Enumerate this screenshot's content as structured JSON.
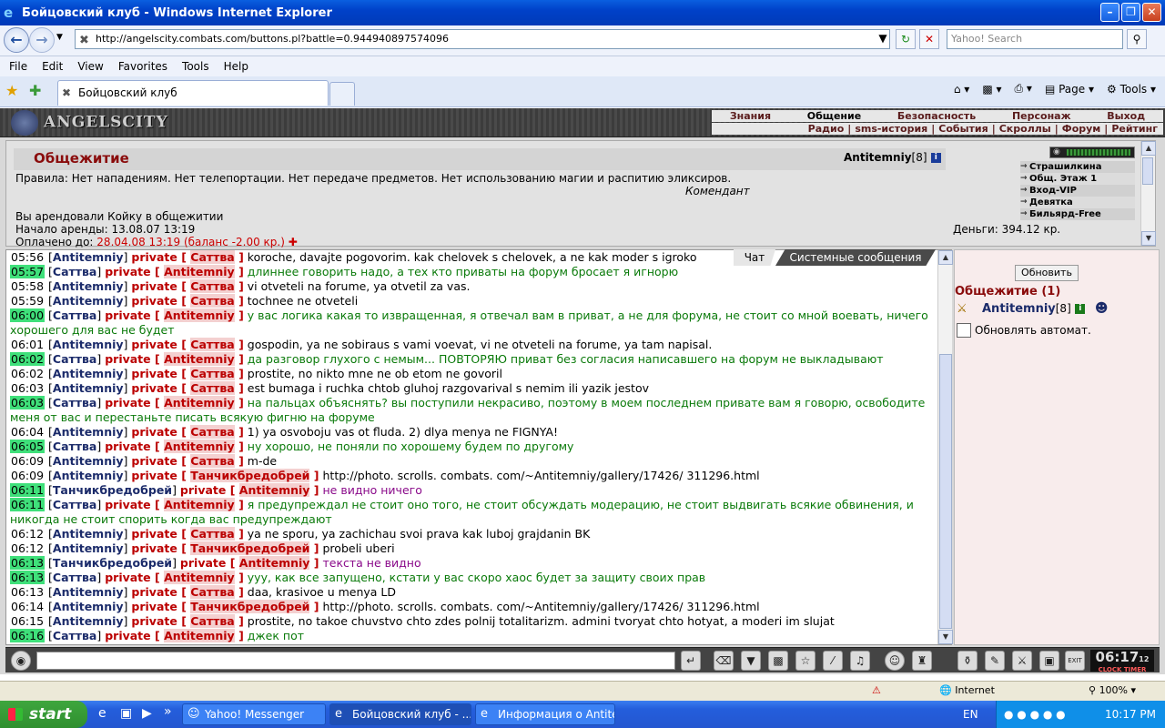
{
  "window": {
    "title": "Бойцовский клуб - Windows Internet Explorer"
  },
  "address": {
    "url": "http://angelscity.combats.com/buttons.pl?battle=0.944940897574096",
    "search_placeholder": "Yahoo! Search"
  },
  "menu": [
    "File",
    "Edit",
    "View",
    "Favorites",
    "Tools",
    "Help"
  ],
  "tabs": {
    "active": "Бойцовский клуб"
  },
  "commandbar": {
    "page": "Page",
    "tools": "Tools"
  },
  "site": {
    "logo": "ANGELSCITY",
    "topnav": [
      "Знания",
      "Общение",
      "Безопасность",
      "Персонаж",
      "Выход"
    ],
    "subnav": [
      "Радио",
      "sms-история",
      "События",
      "Скроллы",
      "Форум",
      "Рейтинг"
    ]
  },
  "room": {
    "title": "Общежитие",
    "user": "Antitemniy",
    "level": "[8]",
    "rules": "Правила: Нет нападениям. Нет телепортации. Нет передаче предметов. Нет использованию магии и распитию эликсиров.",
    "signed": "Комендант",
    "rent1": "Вы арендовали Койку в общежитии",
    "rent2": "Начало аренды: 13.08.07 13:19",
    "paid_label": "Оплачено до: ",
    "paid_value": "28.04.08 13:19 (баланс -2.00 кр.)",
    "money": "Деньги: 394.12 кр.",
    "links": [
      "Страшилкина улица",
      "Общ. Этаж 1",
      "Вход-VIP",
      "Девятка",
      "Бильярд-Free"
    ]
  },
  "chat_tabs": {
    "chat": "Чат",
    "system": "Системные сообщения"
  },
  "chat": [
    {
      "t": "05:56",
      "g": false,
      "n": "Antitemniy",
      "p": "Саттва",
      "m": "koroche, davajte pogovorim. kak chelovek s chelovek, a ne kak moder s igroko",
      "c": "m0"
    },
    {
      "t": "05:57",
      "g": true,
      "n": "Саттва",
      "p": "Antitemniy",
      "m": "длиннее говорить надо, а тех кто приваты на форум бросает я игнорю",
      "c": "mg"
    },
    {
      "t": "05:58",
      "g": false,
      "n": "Antitemniy",
      "p": "Саттва",
      "m": "vi otveteli na forume, ya otvetil za vas.",
      "c": "m0"
    },
    {
      "t": "05:59",
      "g": false,
      "n": "Antitemniy",
      "p": "Саттва",
      "m": "tochnee ne otveteli",
      "c": "m0"
    },
    {
      "t": "06:00",
      "g": true,
      "n": "Саттва",
      "p": "Antitemniy",
      "m": "у вас логика какая то извращенная, я отвечал вам в приват, а не для форума, не стоит со мной воевать, ничего хорошего для вас не будет",
      "c": "mg"
    },
    {
      "t": "06:01",
      "g": false,
      "n": "Antitemniy",
      "p": "Саттва",
      "m": "gospodin, ya ne sobiraus s vami voevat, vi ne otveteli na forume, ya tam napisal.",
      "c": "m0"
    },
    {
      "t": "06:02",
      "g": true,
      "n": "Саттва",
      "p": "Antitemniy",
      "m": "да разговор глухого с немым... ПОВТОРЯЮ приват без согласия написавшего на форум не выкладывают",
      "c": "mg"
    },
    {
      "t": "06:02",
      "g": false,
      "n": "Antitemniy",
      "p": "Саттва",
      "m": "prostite, no nikto mne ne ob etom ne govoril",
      "c": "m0"
    },
    {
      "t": "06:03",
      "g": false,
      "n": "Antitemniy",
      "p": "Саттва",
      "m": "est bumaga i ruchka chtob gluhoj razgovarival s nemim ili yazik jestov",
      "c": "m0"
    },
    {
      "t": "06:03",
      "g": true,
      "n": "Саттва",
      "p": "Antitemniy",
      "m": "на пальцах объяснять? вы поступили некрасиво, поэтому в моем последнем привате вам я говорю, освободите меня от вас и перестаньте писать всякую фигню на форуме",
      "c": "mg"
    },
    {
      "t": "06:04",
      "g": false,
      "n": "Antitemniy",
      "p": "Саттва",
      "m": "1) ya osvoboju vas ot fluda. 2) dlya menya ne FIGNYA!",
      "c": "m0"
    },
    {
      "t": "06:05",
      "g": true,
      "n": "Саттва",
      "p": "Antitemniy",
      "m": "ну хорошо, не поняли по хорошему будем по другому",
      "c": "mg"
    },
    {
      "t": "06:09",
      "g": false,
      "n": "Antitemniy",
      "p": "Саттва",
      "m": "m-de",
      "c": "m0"
    },
    {
      "t": "06:09",
      "g": false,
      "n": "Antitemniy",
      "p": "Танчикбредобрей",
      "m": "http://photo. scrolls. combats. com/~Antitemniy/gallery/17426/ 311296.html",
      "c": "m0"
    },
    {
      "t": "06:11",
      "g": true,
      "n": "Танчикбредобрей",
      "p": "Antitemniy",
      "m": "не видно ничего",
      "c": "mp"
    },
    {
      "t": "06:11",
      "g": true,
      "n": "Саттва",
      "p": "Antitemniy",
      "m": "я предупреждал не стоит оно того, не стоит обсуждать модерацию, не стоит выдвигать всякие обвинения, и никогда не стоит спорить когда вас предупреждают",
      "c": "mg"
    },
    {
      "t": "06:12",
      "g": false,
      "n": "Antitemniy",
      "p": "Саттва",
      "m": "ya ne sporu, ya zachichau svoi prava kak luboj grajdanin BK",
      "c": "m0"
    },
    {
      "t": "06:12",
      "g": false,
      "n": "Antitemniy",
      "p": "Танчикбредобрей",
      "m": "probeli uberi",
      "c": "m0"
    },
    {
      "t": "06:13",
      "g": true,
      "n": "Танчикбредобрей",
      "p": "Antitemniy",
      "m": "текста не видно",
      "c": "mp"
    },
    {
      "t": "06:13",
      "g": true,
      "n": "Саттва",
      "p": "Antitemniy",
      "m": "ууу, как все запущено, кстати у вас скоро хаос будет за защиту своих прав",
      "c": "mg"
    },
    {
      "t": "06:13",
      "g": false,
      "n": "Antitemniy",
      "p": "Саттва",
      "m": "daa, krasivoe u menya LD",
      "c": "m0"
    },
    {
      "t": "06:14",
      "g": false,
      "n": "Antitemniy",
      "p": "Танчикбредобрей",
      "m": "http://photo. scrolls. combats. com/~Antitemniy/gallery/17426/ 311296.html",
      "c": "m0"
    },
    {
      "t": "06:15",
      "g": false,
      "n": "Antitemniy",
      "p": "Саттва",
      "m": "prostite, no takoe chuvstvo chto zdes polnij totalitarizm. admini tvoryat chto hotyat, a moderi im slujat",
      "c": "m0"
    },
    {
      "t": "06:16",
      "g": true,
      "n": "Саттва",
      "p": "Antitemniy",
      "m": "джек пот",
      "c": "mg"
    }
  ],
  "side": {
    "refresh": "Обновить",
    "title": "Общежитие (1)",
    "user": "Antitemniy",
    "level": "[8]",
    "auto": "Обновлять автомат."
  },
  "clock": {
    "time": "06:17",
    "sec": "12",
    "labels": "CLOCK TIMER"
  },
  "status": {
    "zone": "Internet",
    "zoom": "100%"
  },
  "taskbar": {
    "start": "start",
    "items": [
      "Yahoo! Messenger",
      "Бойцовский клуб - ...",
      "Информация о Antite..."
    ],
    "lang": "EN",
    "time": "10:17 PM"
  }
}
